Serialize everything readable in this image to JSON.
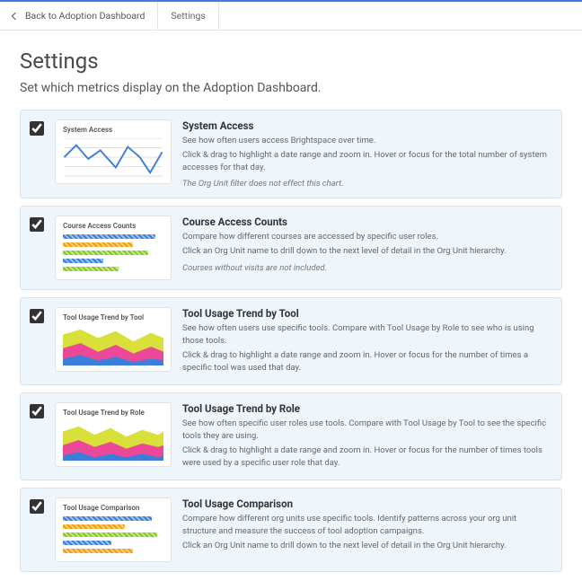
{
  "topbar": {
    "back_label": "Back to Adoption Dashboard",
    "breadcrumb_current": "Settings"
  },
  "page": {
    "title": "Settings",
    "subtitle": "Set which metrics display on the Adoption Dashboard."
  },
  "metrics": [
    {
      "thumb_label": "System Access",
      "title": "System Access",
      "desc1": "See how often users access Brightspace over time.",
      "desc2": "Click & drag to highlight a date range and zoom in. Hover or focus for the total number of system accesses for that day.",
      "note": "The Org Unit filter does not effect this chart."
    },
    {
      "thumb_label": "Course Access Counts",
      "title": "Course Access Counts",
      "desc1": "Compare how different courses are accessed by specific user roles.",
      "desc2": "Click an Org Unit name to drill down to the next level of detail in the Org Unit hierarchy.",
      "note": "Courses without visits are not included."
    },
    {
      "thumb_label": "Tool Usage Trend by Tool",
      "title": "Tool Usage Trend by Tool",
      "desc1": "See how often users use specific tools. Compare with Tool Usage by Role to see who is using those tools.",
      "desc2": "Click & drag to highlight a date range and zoom in. Hover or focus for the number of times a specific tool was used that day.",
      "note": ""
    },
    {
      "thumb_label": "Tool Usage Trend by Role",
      "title": "Tool Usage Trend by Role",
      "desc1": "See how often specific user roles use tools. Compare with Tool Usage by Tool to see the specific tools they are using.",
      "desc2": "Click & drag to highlight a date range and zoom in. Hover or focus for the number of times tools were used by a specific user role that day.",
      "note": ""
    },
    {
      "thumb_label": "Tool Usage Comparison",
      "title": "Tool Usage Comparison",
      "desc1": "Compare how different org units use specific tools. Identify patterns across your org unit structure and measure the success of tool adoption campaigns.",
      "desc2": "Click an Org Unit name to drill down to the next level of detail in the Org Unit hierarchy.",
      "note": ""
    }
  ]
}
